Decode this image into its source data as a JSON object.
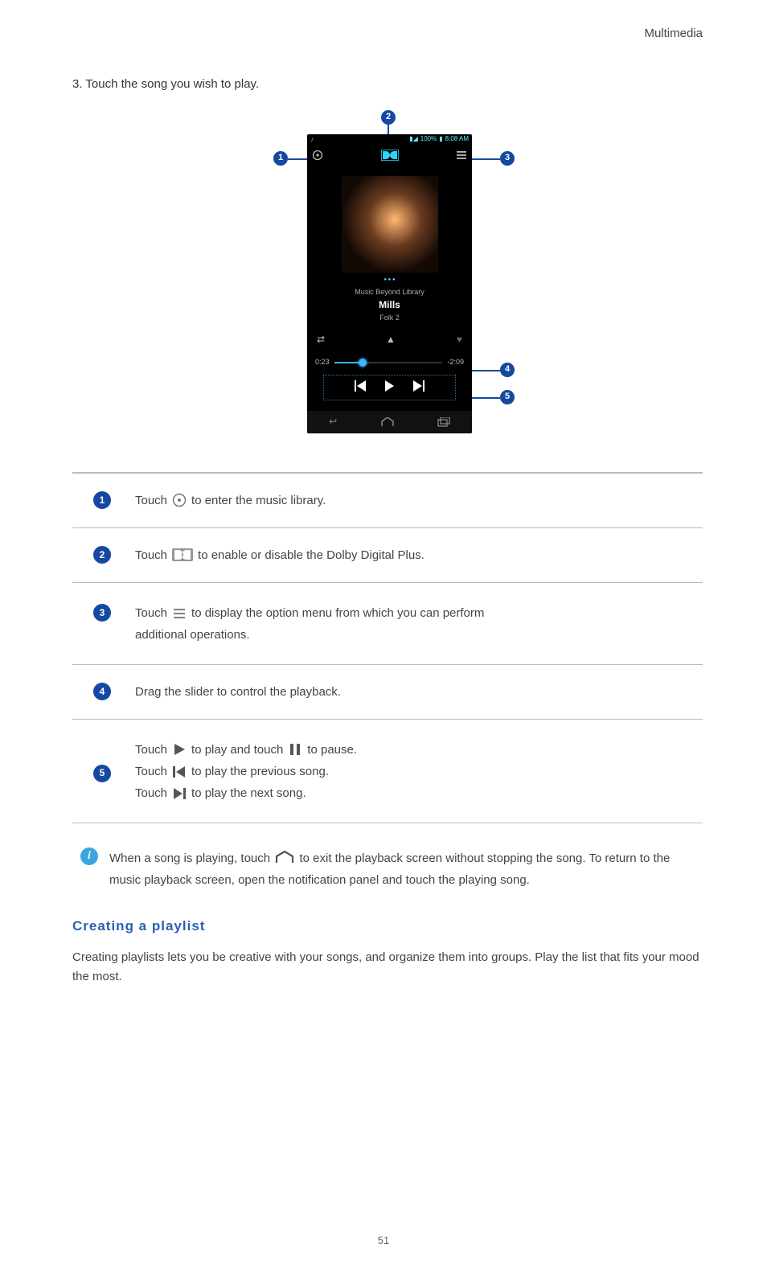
{
  "header": {
    "section": "Multimedia"
  },
  "step": {
    "num": "3.",
    "text": "Touch the song you wish to play."
  },
  "statusbar": {
    "signal": "100%",
    "time": "8:08 AM"
  },
  "player": {
    "library_label": "Music Beyond Library",
    "track_title": "Mills",
    "album_name": "Folk 2",
    "elapsed": "0:23",
    "remaining": "-2:09"
  },
  "callouts": {
    "n1": "1",
    "n2": "2",
    "n3": "3",
    "n4": "4",
    "n5": "5"
  },
  "expl": {
    "row1": {
      "num": "1",
      "pre": "Touch",
      "post": "to enter the music library."
    },
    "row2": {
      "num": "2",
      "pre": "Touch",
      "post": "to enable or disable the Dolby Digital Plus."
    },
    "row3": {
      "num": "3",
      "pre": "Touch",
      "post_a": "to display the option menu from which you can perform",
      "post_b": "additional operations."
    },
    "row4": {
      "num": "4",
      "text": "Drag the slider to control the playback."
    },
    "row5": {
      "num": "5",
      "a_pre": "Touch",
      "a_mid": "to play and touch",
      "a_post": "to pause.",
      "b_pre": "Touch",
      "b_post": "to play the previous song.",
      "c_pre": "Touch",
      "c_post": "to play the next song."
    }
  },
  "tip": {
    "pre": "When a song is playing, touch",
    "post": "to exit the playback screen without stopping the song. To return to the music playback screen, open the notification panel and touch the playing song."
  },
  "subsection": {
    "title": "Creating a playlist"
  },
  "paragraph": {
    "text": "Creating playlists lets you be creative with your songs, and organize them into groups. Play the list that fits your mood the most."
  },
  "page": {
    "number": "51"
  }
}
